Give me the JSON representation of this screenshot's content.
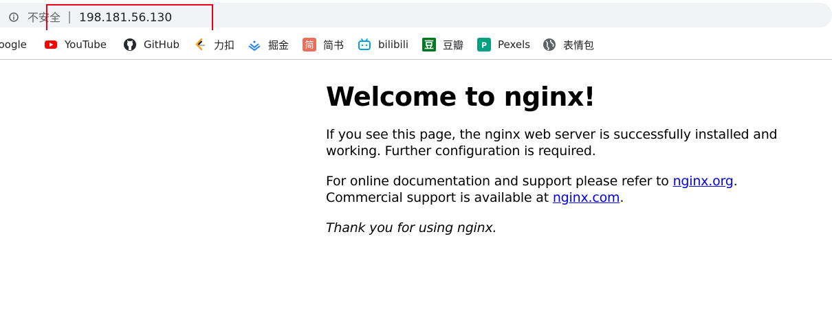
{
  "omnibox": {
    "security_label": "不安全",
    "separator": "|",
    "url": "198.181.56.130"
  },
  "bookmarks": [
    {
      "label": "Google",
      "icon": "google-icon"
    },
    {
      "label": "YouTube",
      "icon": "youtube-icon"
    },
    {
      "label": "GitHub",
      "icon": "github-icon"
    },
    {
      "label": "力扣",
      "icon": "leetcode-icon"
    },
    {
      "label": "掘金",
      "icon": "juejin-icon"
    },
    {
      "label": "简书",
      "icon": "jianshu-icon"
    },
    {
      "label": "bilibili",
      "icon": "bilibili-icon"
    },
    {
      "label": "豆瓣",
      "icon": "douban-icon"
    },
    {
      "label": "Pexels",
      "icon": "pexels-icon"
    },
    {
      "label": "表情包",
      "icon": "globe-icon"
    }
  ],
  "page": {
    "title": "Welcome to nginx!",
    "para1": "If you see this page, the nginx web server is successfully installed and working. Further configuration is required.",
    "para2_prefix": "For online documentation and support please refer to ",
    "link1": "nginx.org",
    "para2_mid": ".",
    "para2_line2_prefix": "Commercial support is available at ",
    "link2": "nginx.com",
    "para2_suffix": ".",
    "thanks": "Thank you for using nginx."
  },
  "colors": {
    "youtube": "#ff0000",
    "jianshu": "#ea6f5a",
    "bilibili": "#00a1d6",
    "douban": "#007722",
    "pexels": "#05a081",
    "link": "#0000ee",
    "highlight": "#e8001a"
  }
}
